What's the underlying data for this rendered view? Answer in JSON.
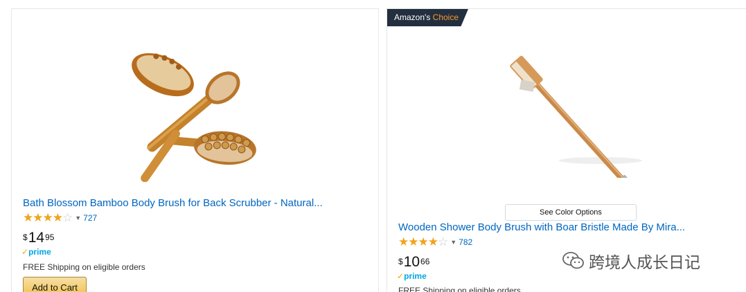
{
  "products": [
    {
      "title": "Bath Blossom Bamboo Body Brush for Back Scrubber - Natural...",
      "rating": 4,
      "rating_max": 5,
      "review_count": "727",
      "price_currency": "$",
      "price_whole": "14",
      "price_fraction": "95",
      "prime_label": "prime",
      "shipping": "FREE Shipping on eligible orders",
      "add_to_cart_label": "Add to Cart"
    },
    {
      "badge_prefix": "Amazon's",
      "badge_choice": "Choice",
      "see_color_options_label": "See Color Options",
      "title": "Wooden Shower Body Brush with Boar Bristle Made By Mira...",
      "rating": 4,
      "rating_max": 5,
      "review_count": "782",
      "price_currency": "$",
      "price_whole": "10",
      "price_fraction": "66",
      "prime_label": "prime",
      "shipping": "FREE Shipping on eligible orders"
    }
  ],
  "watermark": {
    "text": "跨境人成长日记",
    "icon": "wechat-icon"
  },
  "colors": {
    "link": "#0066c0",
    "star": "#f0a31b",
    "prime": "#00a8e1",
    "badge_bg": "#232f3e",
    "badge_accent": "#f69931",
    "cart_button": "#f0c14b"
  }
}
